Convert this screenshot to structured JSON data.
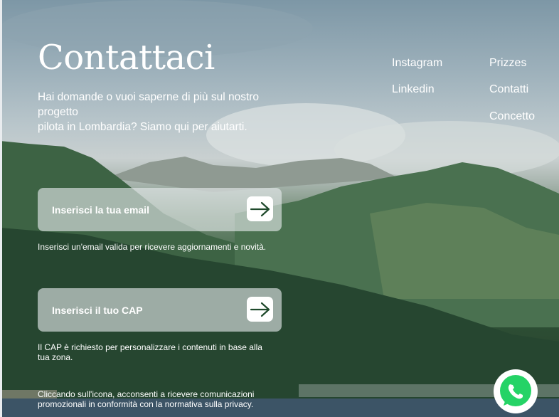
{
  "page": {
    "title": "Contattaci",
    "subtitle_lines": [
      "Hai domande o vuoi saperne di più sul nostro",
      "progetto",
      "pilota in Lombardia? Siamo qui per aiutarti."
    ]
  },
  "nav": {
    "col1": [
      "Instagram",
      "Linkedin"
    ],
    "col2": [
      "Prizzes",
      "Contatti",
      "Concetto"
    ]
  },
  "email_field": {
    "placeholder": "Inserisci la tua email",
    "value": "",
    "hint": "Inserisci un'email valida per ricevere aggiornamenti e novità."
  },
  "cap_field": {
    "placeholder": "Inserisci il tuo CAP",
    "value": "",
    "hint": "Il CAP è richiesto per personalizzare i contenuti in base alla tua zona."
  },
  "privacy_note": "Cliccando sull'icona, acconsenti a ricevere comunicazioni promozionali in conformità con la normativa sulla privacy.",
  "icons": {
    "submit": "arrow-right-icon",
    "chat": "whatsapp-icon"
  },
  "colors": {
    "accent": "#1f4a2c",
    "whatsapp": "#25d366"
  }
}
